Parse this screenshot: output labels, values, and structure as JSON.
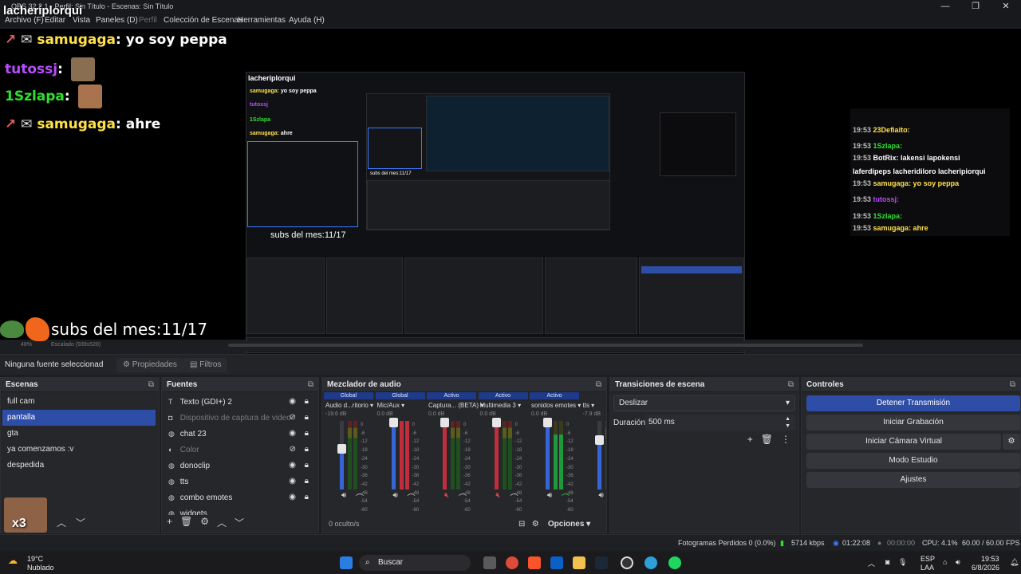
{
  "window": {
    "title": "OBS 32.2.1 - Perfil: Sin Título - Escenas: Sin Título",
    "minimize_label": "—",
    "maximize_label": "❐",
    "close_label": "✕"
  },
  "menu": {
    "items": [
      "Archivo (F)",
      "Editar",
      "Vista",
      "Paneles (D)",
      "Perfil",
      "Colección de Escenas",
      "Herramientas",
      "Ayuda (H)"
    ]
  },
  "preview": {
    "streamer_name": "lacheriplorqui",
    "chat": [
      {
        "user": "samugaga",
        "msg": "yo soy peppa"
      },
      {
        "user": "tutossj",
        "msg": ""
      },
      {
        "user": "1Szlapa",
        "msg": ""
      },
      {
        "user": "samugaga",
        "msg": "ahre"
      }
    ],
    "subs_label": "subs del mes:11/17",
    "nested_subs_label": "subs del mes:11/17",
    "zoom_label": "48%",
    "scale_label": "Escalado (939x528)",
    "x3_label": "x3",
    "right_chat": [
      {
        "time": "19:53",
        "text": "23Defiaito:"
      },
      {
        "time": "19:53",
        "text": "1Szlapa:"
      },
      {
        "time": "19:53",
        "text": "BotRix: lakensi lapokensi"
      },
      {
        "time": "",
        "text": "laferdipeps lacheridiloro lacheripiorqui"
      },
      {
        "time": "19:53",
        "text": "samugaga: yo soy peppa"
      },
      {
        "time": "19:53",
        "text": "tutossj:"
      },
      {
        "time": "19:53",
        "text": "1Szlapa:"
      },
      {
        "time": "19:53",
        "text": "samugaga: ahre"
      }
    ]
  },
  "properties_bar": {
    "no_source": "Ninguna fuente seleccionad",
    "properties": "Propiedades",
    "filters": "Filtros"
  },
  "scenes": {
    "title": "Escenas",
    "items": [
      "full cam",
      "pantalla",
      "gta",
      "ya comenzamos :v",
      "despedida"
    ],
    "selected": "pantalla"
  },
  "sources": {
    "title": "Fuentes",
    "items": [
      {
        "label": "Texto (GDI+) 2",
        "icon": "text-icon",
        "visible": true
      },
      {
        "label": "Dispositivo de captura de video",
        "icon": "camera-icon",
        "visible": false
      },
      {
        "label": "chat 23",
        "icon": "browser-icon",
        "visible": true
      },
      {
        "label": "Color",
        "icon": "color-icon",
        "visible": false
      },
      {
        "label": "donoclip",
        "icon": "browser-icon",
        "visible": true
      },
      {
        "label": "tts",
        "icon": "browser-icon",
        "visible": true
      },
      {
        "label": "combo emotes",
        "icon": "browser-icon",
        "visible": true
      },
      {
        "label": "widgets",
        "icon": "browser-icon",
        "visible": true
      }
    ]
  },
  "mixer": {
    "title": "Mezclador de audio",
    "hidden_label": "0 oculto/s",
    "options_label": "Opciones",
    "scale": [
      "0",
      "-6",
      "-12",
      "-18",
      "-24",
      "-30",
      "-36",
      "-42",
      "-48",
      "-54",
      "-60"
    ],
    "channels": [
      {
        "tag": "Global",
        "name": "Audio d...ritorio",
        "db": "-19.6 dB",
        "level": 0.62,
        "muted": false
      },
      {
        "tag": "Global",
        "name": "Mic/Aux",
        "db": "0.0 dB",
        "level": 1.0,
        "muted": false
      },
      {
        "tag": "Activo",
        "name": "Captura... (BETA)",
        "db": "0.0 dB",
        "level": 1.0,
        "muted": true
      },
      {
        "tag": "Activo",
        "name": "Multimedia 3",
        "db": "0.0 dB",
        "level": 1.0,
        "muted": true
      },
      {
        "tag": "Activo",
        "name": "sonidos emotes",
        "db": "0.0 dB",
        "level": 1.0,
        "muted": false
      },
      {
        "tag": "",
        "name": "tts",
        "db": "-7.9 dB",
        "level": 0.74,
        "muted": false
      }
    ]
  },
  "transitions": {
    "title": "Transiciones de escena",
    "selected": "Deslizar",
    "duration_label": "Duración",
    "duration_value": "500 ms"
  },
  "controls": {
    "title": "Controles",
    "stop_stream": "Detener Transmisión",
    "start_record": "Iniciar Grabación",
    "start_vcam": "Iniciar Cámara Virtual",
    "studio_mode": "Modo Estudio",
    "settings": "Ajustes"
  },
  "status": {
    "dropped": "Fotogramas Perdidos 0 (0.0%)",
    "bitrate": "5714 kbps",
    "live_time": "01:22:08",
    "rec_time": "00:00:00",
    "cpu": "CPU: 4.1%",
    "fps": "60.00 / 60.00 FPS"
  },
  "taskbar": {
    "weather_temp": "19°C",
    "weather_desc": "Nublado",
    "search": "Buscar",
    "lang": "ESP",
    "lang2": "LAA",
    "time": "19:53",
    "date": "6/8/2026"
  },
  "colors": {
    "accent": "#2e4da7",
    "live_green": "#2fe02f"
  }
}
